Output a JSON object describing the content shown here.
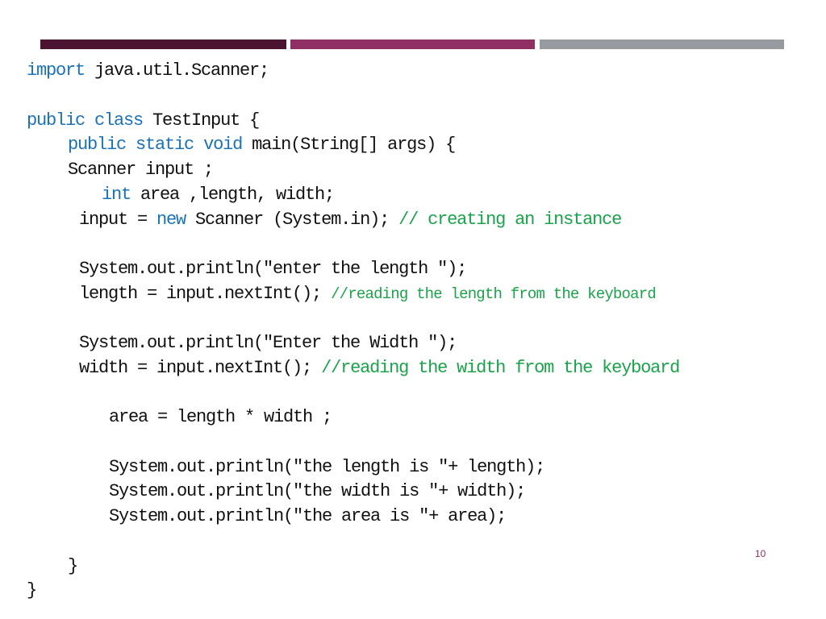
{
  "slide": {
    "colors": {
      "bar1": "#4a1330",
      "bar2": "#8f2f63",
      "bar3": "#979a9f",
      "keyword": "#1a73b8",
      "comment": "#1aa34a",
      "text": "#111111",
      "page_number": "#8f2f63"
    },
    "page_number": "10",
    "code": {
      "l1": {
        "kw": "import",
        "rest": " java.util.Scanner;"
      },
      "l2": {
        "kw1": "public",
        "sp": " ",
        "kw2": "class",
        "rest": " TestInput {"
      },
      "l3": {
        "kw1": "public",
        "kw2": "static",
        "kw3": "void",
        "rest": " main(String[] args) {"
      },
      "l4": {
        "text": "Scanner input ;"
      },
      "l5": {
        "kw": "int",
        "rest": " area ,length, width;"
      },
      "l6": {
        "pre": "input = ",
        "kw": "new",
        "rest": " Scanner (System.in); ",
        "comment": "// creating an instance"
      },
      "l7": {
        "text": "System.out.println(\"enter the length \");"
      },
      "l8": {
        "pre": "length = input.nextInt(); ",
        "comment": "//reading the length from the keyboard"
      },
      "l9": {
        "text": "System.out.println(\"Enter the Width \");"
      },
      "l10": {
        "pre": "width = input.nextInt(); ",
        "comment": "//reading the width from the keyboard"
      },
      "l11": {
        "text": "area = length * width ;"
      },
      "l12": {
        "text": "System.out.println(\"the length is \"+ length);"
      },
      "l13": {
        "text": "System.out.println(\"the width is \"+ width);"
      },
      "l14": {
        "text": "System.out.println(\"the area is \"+ area);"
      },
      "l15": {
        "text": "}"
      },
      "l16": {
        "text": "}"
      }
    }
  }
}
